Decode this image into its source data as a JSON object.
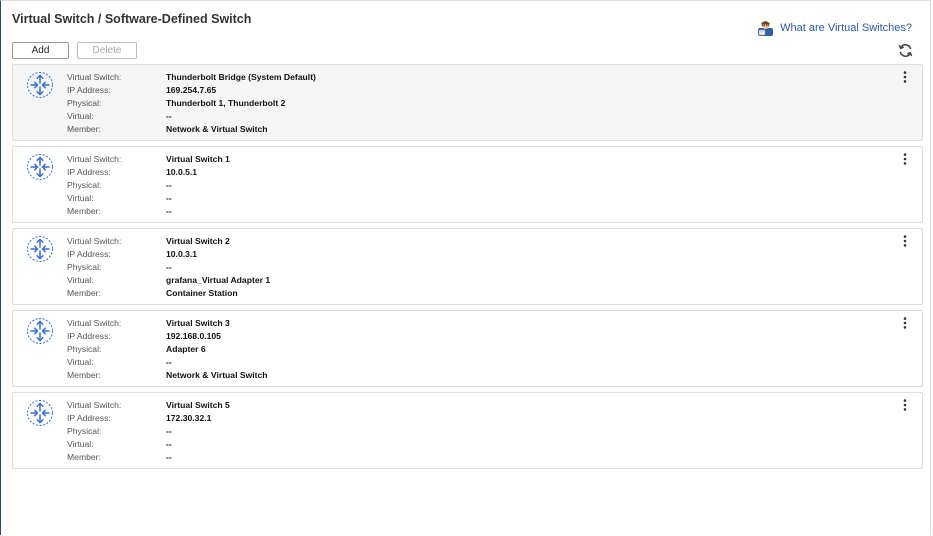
{
  "page": {
    "title": "Virtual Switch / Software-Defined Switch",
    "help_link": "What are Virtual Switches?"
  },
  "toolbar": {
    "add_label": "Add",
    "delete_label": "Delete"
  },
  "labels": {
    "virtual_switch": "Virtual Switch:",
    "ip_address": "IP Address:",
    "physical": "Physical:",
    "virtual": "Virtual:",
    "member": "Member:"
  },
  "switches": [
    {
      "name": "Thunderbolt Bridge (System Default)",
      "ip": "169.254.7.65",
      "physical": "Thunderbolt 1, Thunderbolt 2",
      "virtual": "--",
      "member": "Network & Virtual Switch"
    },
    {
      "name": "Virtual Switch 1",
      "ip": "10.0.5.1",
      "physical": "--",
      "virtual": "--",
      "member": "--"
    },
    {
      "name": "Virtual Switch 2",
      "ip": "10.0.3.1",
      "physical": "--",
      "virtual": "grafana_Virtual Adapter 1",
      "member": "Container Station"
    },
    {
      "name": "Virtual Switch 3",
      "ip": "192.168.0.105",
      "physical": "Adapter 6",
      "virtual": "--",
      "member": "Network & Virtual Switch"
    },
    {
      "name": "Virtual Switch 5",
      "ip": "172.30.32.1",
      "physical": "--",
      "virtual": "--",
      "member": "--"
    }
  ],
  "colors": {
    "accent": "#2a5aa8",
    "selected_bg": "#f5f5f5",
    "icon_blue": "#3a6fcf"
  },
  "icons": {
    "switch": "switch-arrows-icon",
    "help": "helper-person-icon",
    "refresh": "refresh-icon",
    "more": "more-vertical-icon"
  }
}
